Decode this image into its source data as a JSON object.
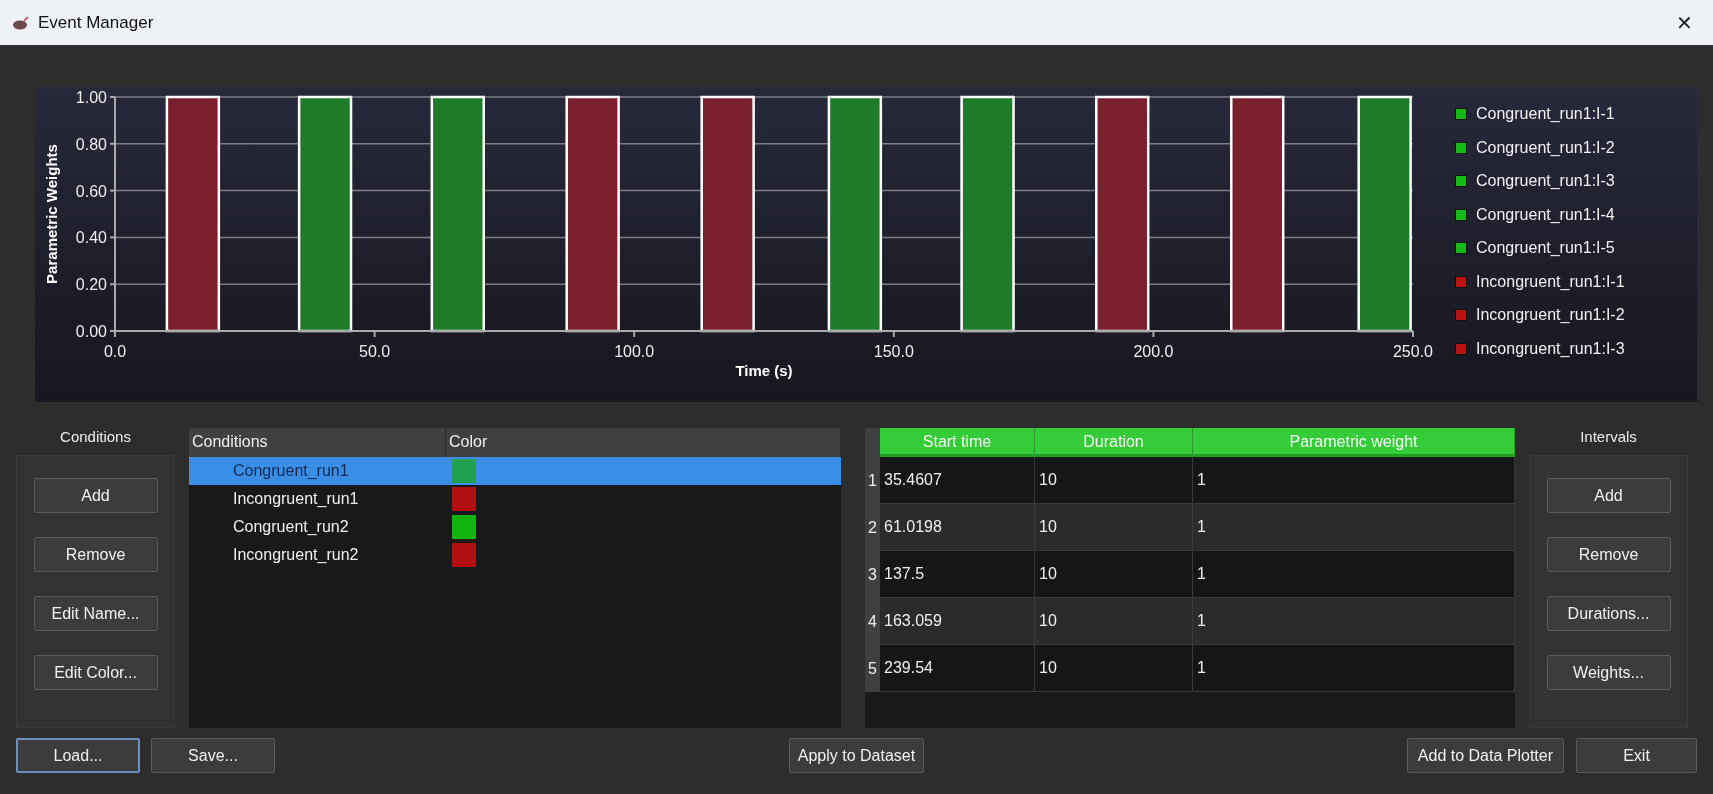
{
  "window": {
    "title": "Event Manager",
    "close": "✕"
  },
  "chart": {
    "chart_data": {
      "type": "bar",
      "grid": true,
      "xlabel": "Time (s)",
      "ylabel": "Parametric Weights",
      "xlim": [
        0,
        250
      ],
      "ylim": [
        0,
        1
      ],
      "xticks": [
        {
          "value": 0,
          "label": "0.0"
        },
        {
          "value": 50,
          "label": "50.0"
        },
        {
          "value": 100,
          "label": "100.0"
        },
        {
          "value": 150,
          "label": "150.0"
        },
        {
          "value": 200,
          "label": "200.0"
        },
        {
          "value": 250,
          "label": "250.0"
        }
      ],
      "yticks": [
        {
          "value": 0,
          "label": "0.00"
        },
        {
          "value": 0.2,
          "label": "0.20"
        },
        {
          "value": 0.4,
          "label": "0.40"
        },
        {
          "value": 0.6,
          "label": "0.60"
        },
        {
          "value": 0.8,
          "label": "0.80"
        },
        {
          "value": 1,
          "label": "1.00"
        }
      ],
      "x": [
        15,
        40.46,
        66.02,
        92,
        118,
        142.5,
        168.06,
        194,
        220,
        244.54
      ],
      "series": [
        {
          "color": "#1f7a2a",
          "values": [
            null,
            1,
            1,
            null,
            null,
            1,
            1,
            null,
            null,
            1
          ]
        },
        {
          "color": "#7a1f2c",
          "values": [
            1,
            null,
            null,
            1,
            1,
            null,
            null,
            1,
            1,
            null
          ]
        }
      ]
    },
    "legend": [
      {
        "label": "Congruent_run1:I-1",
        "color": "#18b818"
      },
      {
        "label": "Congruent_run1:I-2",
        "color": "#18b818"
      },
      {
        "label": "Congruent_run1:I-3",
        "color": "#18b818"
      },
      {
        "label": "Congruent_run1:I-4",
        "color": "#18b818"
      },
      {
        "label": "Congruent_run1:I-5",
        "color": "#18b818"
      },
      {
        "label": "Incongruent_run1:I-1",
        "color": "#b81414"
      },
      {
        "label": "Incongruent_run1:I-2",
        "color": "#b81414"
      },
      {
        "label": "Incongruent_run1:I-3",
        "color": "#b81414"
      }
    ]
  },
  "conditions_panel": {
    "title": "Conditions",
    "buttons": [
      "Add",
      "Remove",
      "Edit Name...",
      "Edit Color..."
    ]
  },
  "conditions_table": {
    "columns": [
      "Conditions",
      "Color"
    ],
    "rows": [
      {
        "name": "Congruent_run1",
        "color": "#22a052",
        "selected": true
      },
      {
        "name": "Incongruent_run1",
        "color": "#b01010",
        "selected": false
      },
      {
        "name": "Congruent_run2",
        "color": "#10b410",
        "selected": false
      },
      {
        "name": "Incongruent_run2",
        "color": "#b01010",
        "selected": false
      }
    ]
  },
  "intervals_table": {
    "columns": [
      "Start time",
      "Duration",
      "Parametric weight"
    ],
    "rows": [
      {
        "index": "1",
        "cells": [
          "35.4607",
          "10",
          "1"
        ]
      },
      {
        "index": "2",
        "cells": [
          "61.0198",
          "10",
          "1"
        ]
      },
      {
        "index": "3",
        "cells": [
          "137.5",
          "10",
          "1"
        ]
      },
      {
        "index": "4",
        "cells": [
          "163.059",
          "10",
          "1"
        ]
      },
      {
        "index": "5",
        "cells": [
          "239.54",
          "10",
          "1"
        ]
      }
    ]
  },
  "intervals_panel": {
    "title": "Intervals",
    "buttons": [
      "Add",
      "Remove",
      "Durations...",
      "Weights..."
    ]
  },
  "footer": {
    "left_buttons": [
      {
        "label": "Load...",
        "focused": true
      },
      {
        "label": "Save...",
        "focused": false
      }
    ],
    "center_button": "Apply to Dataset",
    "right_buttons": [
      "Add to Data Plotter",
      "Exit"
    ]
  }
}
